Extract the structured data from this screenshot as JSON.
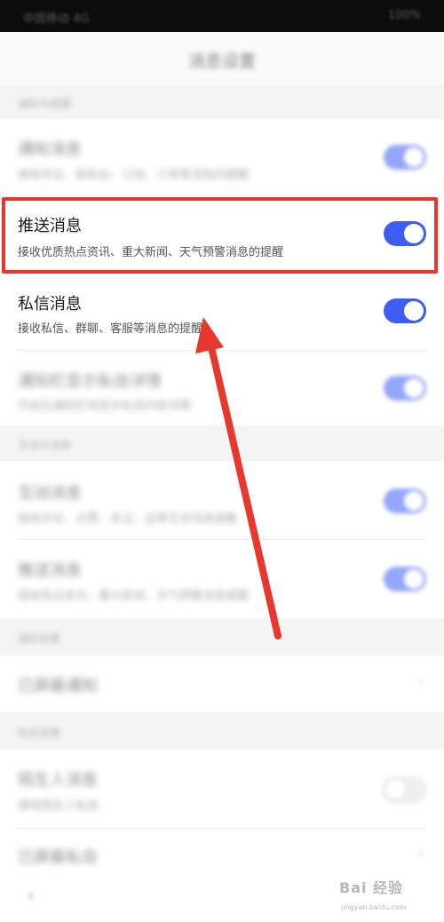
{
  "status_bar": {
    "left": "中国移动 4G",
    "right": "100%"
  },
  "header": {
    "title": "消息设置"
  },
  "sections": [
    {
      "header": "通知与提醒"
    },
    {
      "header": "互动与消息"
    },
    {
      "header": "通知设置"
    },
    {
      "header": "私信设置"
    }
  ],
  "rows": {
    "notify": {
      "title": "通知消息",
      "subtitle": "接收评论、新粉丝、订阅、订单等消息的提醒",
      "on": true
    },
    "push": {
      "title": "推送消息",
      "subtitle": "接收优质热点资讯、重大新闻、天气预警消息的提醒",
      "on": true
    },
    "pm": {
      "title": "私信消息",
      "subtitle": "接收私信、群聊、客服等消息的提醒",
      "on": true
    },
    "privacy": {
      "title": "通知栏显示私信详情",
      "subtitle": "开启后通知栏将显示私信内容详情",
      "on": true
    },
    "interact": {
      "title": "互动消息",
      "subtitle": "接收评论、点赞、关注、@等互动消息提醒",
      "on": true
    },
    "recommend": {
      "title": "推送消息",
      "subtitle": "接收热点资讯、重大新闻、天气预警消息提醒",
      "on": true
    },
    "blocked": {
      "title": "已屏蔽通知"
    },
    "stranger": {
      "title": "陌生人消息",
      "subtitle": "接收陌生人私信",
      "on": false
    },
    "blocked_pm": {
      "title": "已屏蔽私信"
    }
  },
  "watermark": {
    "brand": "Bai 经验",
    "url": "jingyan.baidu.com"
  },
  "colors": {
    "toggle_on": "#3d5ef2",
    "highlight": "#e8372c",
    "arrow": "#e8372c"
  },
  "icons": {
    "back": "chevron-left-icon",
    "chevron": "chevron-right-icon"
  }
}
